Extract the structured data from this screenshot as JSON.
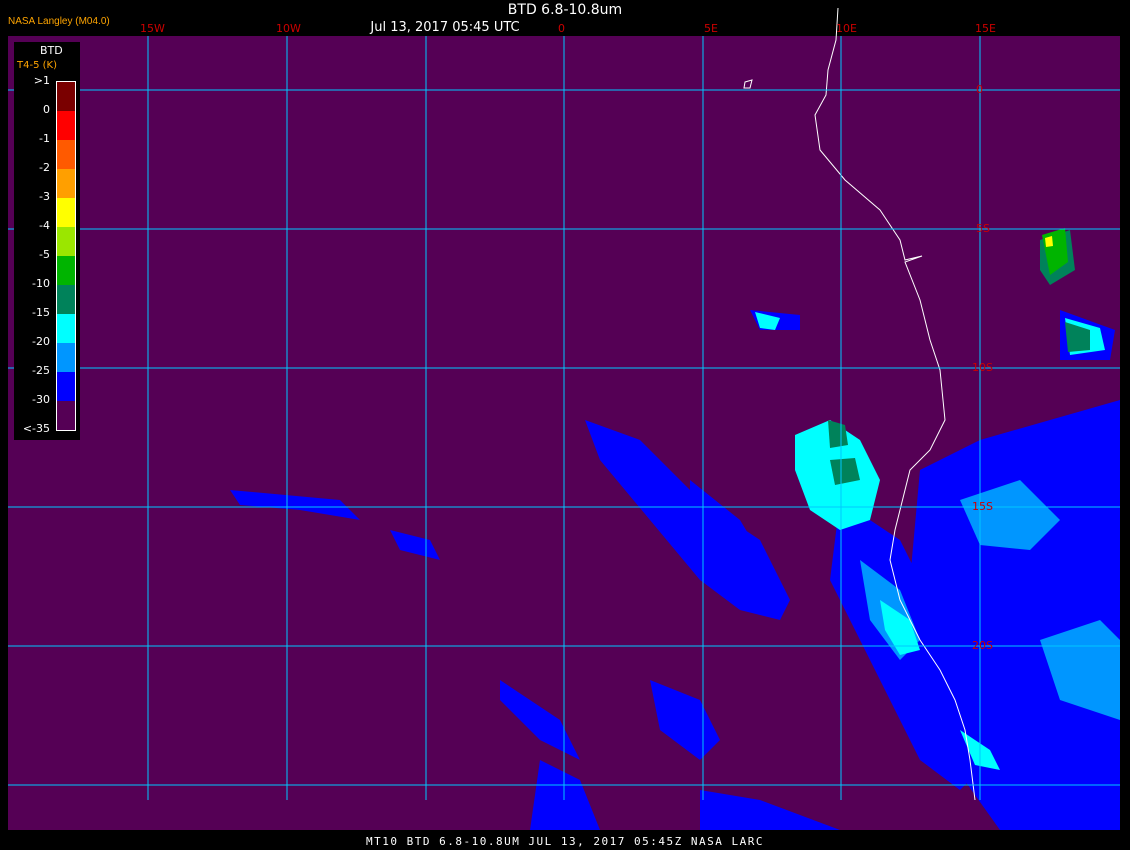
{
  "header": {
    "title": "BTD 6.8-10.8um",
    "datetime": "Jul 13, 2017 05:45 UTC",
    "provider": "NASA Langley (M04.0)"
  },
  "legend": {
    "title": "BTD",
    "subtitle": "T4-5 (K)",
    "ticks": [
      ">1",
      "0",
      "-1",
      "-2",
      "-3",
      "-4",
      "-5",
      "-10",
      "-15",
      "-20",
      "-25",
      "-30",
      "<-35"
    ],
    "colors": [
      "#7a0000",
      "#ff0000",
      "#ff5a00",
      "#ff9f00",
      "#ffff00",
      "#9be600",
      "#00b400",
      "#00825a",
      "#00ffff",
      "#0096ff",
      "#0000ff",
      "#550055"
    ]
  },
  "grid": {
    "lon_labels": [
      "15W",
      "10W",
      "0",
      "5E",
      "10E",
      "15E"
    ],
    "lat_labels": [
      "0",
      "5S",
      "10S",
      "15S",
      "20S"
    ],
    "line_color": "#00c8ff"
  },
  "footer": "MT10  BTD 6.8-10.8UM   JUL 13, 2017 05:45Z   NASA LARC",
  "colors": {
    "background": "#550055",
    "coast": "#ffffff"
  }
}
